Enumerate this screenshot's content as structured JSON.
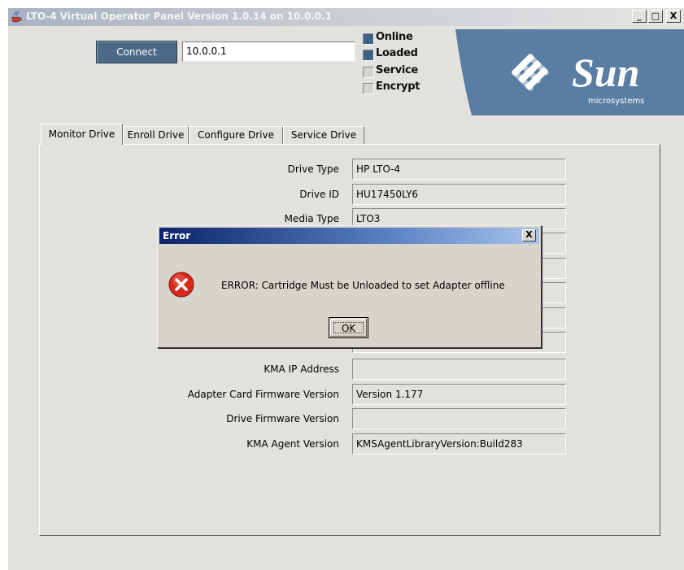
{
  "window": {
    "title": "LTO-4 Virtual Operator Panel Version 1.0.14 on 10.0.0.1",
    "minimize_glyph": "_",
    "maximize_glyph": "□",
    "close_glyph": "X"
  },
  "toolbar": {
    "connect_label": "Connect",
    "ip_value": "10.0.0.1"
  },
  "status": [
    {
      "label": "Online",
      "active": true
    },
    {
      "label": "Loaded",
      "active": true
    },
    {
      "label": "Service",
      "active": false
    },
    {
      "label": "Encrypt",
      "active": false
    }
  ],
  "logo": {
    "name": "Sun",
    "tagline": "microsystems",
    "background": "#5a7ea2"
  },
  "tabs": [
    "Monitor Drive",
    "Enroll Drive",
    "Configure Drive",
    "Service Drive"
  ],
  "active_tab": "Monitor Drive",
  "fields": [
    {
      "label": "Drive Type",
      "value": "HP LTO-4"
    },
    {
      "label": "Drive ID",
      "value": "HU17450LY6"
    },
    {
      "label": "Media Type",
      "value": "LTO3"
    },
    {
      "label": "",
      "value": ""
    },
    {
      "label": "",
      "value": ""
    },
    {
      "label": "",
      "value": ""
    },
    {
      "label": "",
      "value": ""
    },
    {
      "label": "",
      "value": ""
    },
    {
      "label": "KMA IP Address",
      "value": ""
    },
    {
      "label": "Adapter Card Firmware Version",
      "value": "Version 1.177"
    },
    {
      "label": "Drive Firmware Version",
      "value": ""
    },
    {
      "label": "KMA Agent Version",
      "value": "KMSAgentLibraryVersion:Build283"
    }
  ],
  "dialog": {
    "title": "Error",
    "message": "ERROR: Cartridge Must be Unloaded to set Adapter offline",
    "ok_label": "OK",
    "close_glyph": "X",
    "icon": "error-icon"
  },
  "colors": {
    "status_on": "#3d6288",
    "status_off": "#d4d2cc",
    "connect_bg": "#4a6a86",
    "error_red": "#d8281c"
  }
}
